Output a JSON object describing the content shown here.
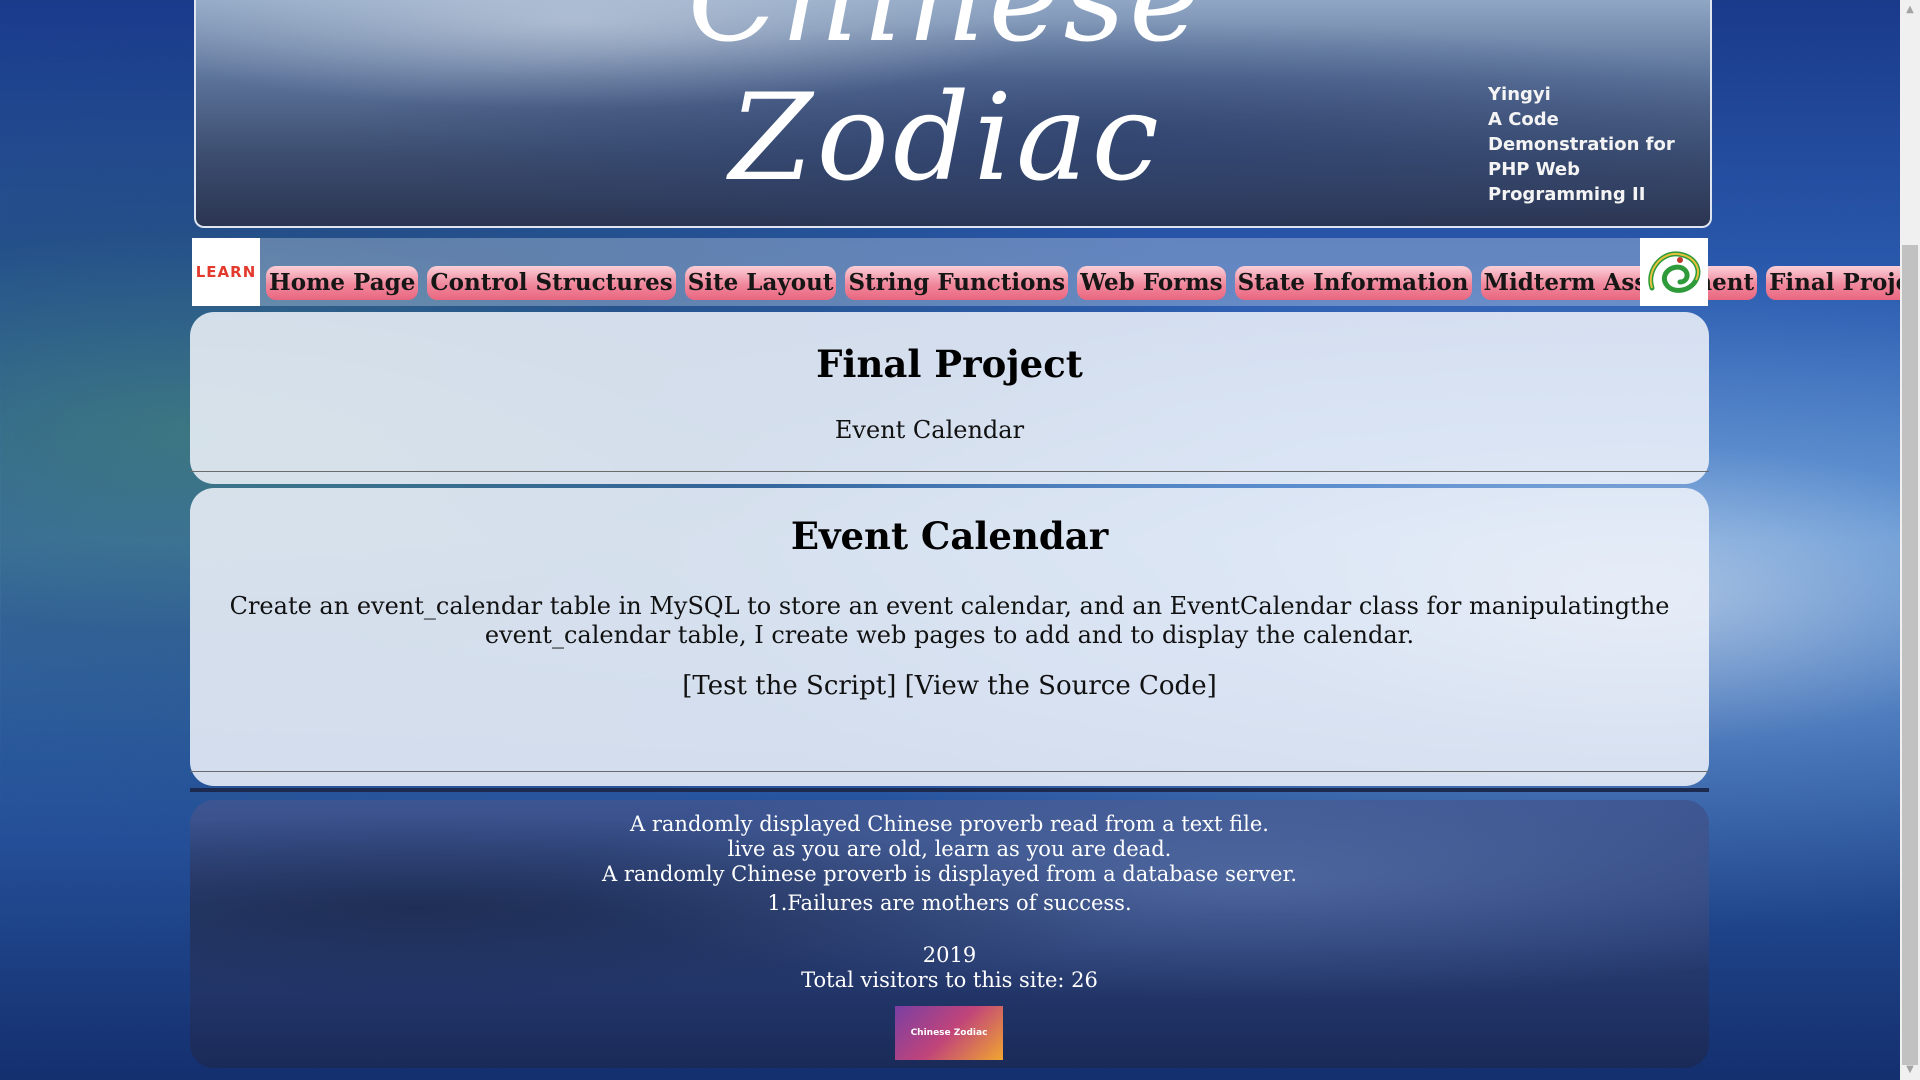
{
  "banner": {
    "title": "Chinese Zodiac",
    "author_lines": [
      "Yingyi",
      "A Code",
      "Demonstration for",
      "PHP Web",
      "Programming II"
    ]
  },
  "nav": {
    "logo_left_text": "LEARN",
    "items": [
      "Home Page",
      "Control Structures",
      "Site Layout",
      "String Functions",
      "Web Forms",
      "State Information",
      "Midterm Assessment",
      "Final Project"
    ]
  },
  "header_panel": {
    "title": "Final Project",
    "subtitle": "Event Calendar"
  },
  "content_panel": {
    "title": "Event Calendar",
    "description": "Create an event_calendar table in MySQL to store an event calendar, and an EventCalendar class for manipulatingthe event_calendar table, I create web pages to add and to display the calendar.",
    "link_test": "[Test the Script]",
    "link_source": "[View the Source Code]"
  },
  "footer": {
    "proverb_intro": "A randomly displayed Chinese proverb read from a text file.",
    "proverb_text": "live as you are old, learn as you are dead.",
    "db_intro": "A randomly Chinese proverb is displayed from a database server.",
    "db_proverb": "1.Failures are mothers of success.",
    "year": "2019",
    "visitors": "Total visitors to this site: 26",
    "image_label": "Chinese Zodiac"
  },
  "colors": {
    "nav_button": "#f0879c",
    "panel_bg": "#f0f3fa",
    "footer_bg": "#2a4078"
  }
}
